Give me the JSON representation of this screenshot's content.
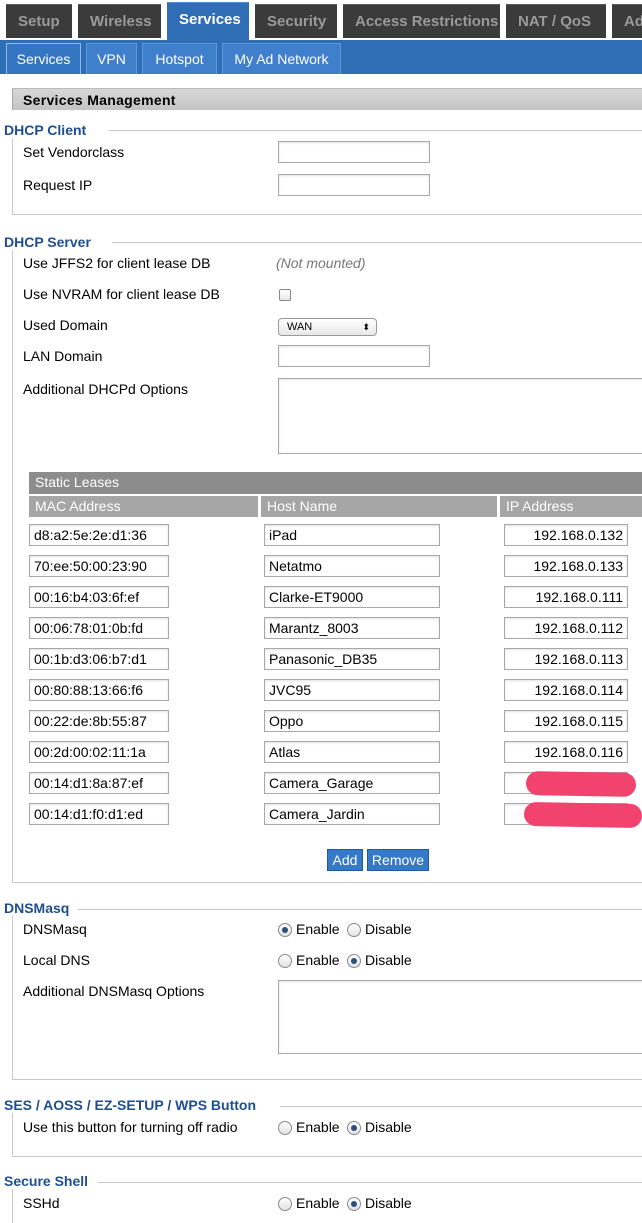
{
  "nav": {
    "tabs": [
      {
        "label": "Setup",
        "active": false
      },
      {
        "label": "Wireless",
        "active": false
      },
      {
        "label": "Services",
        "active": true
      },
      {
        "label": "Security",
        "active": false
      },
      {
        "label": "Access Restrictions",
        "active": false
      },
      {
        "label": "NAT / QoS",
        "active": false
      },
      {
        "label": "Ad",
        "active": false
      }
    ],
    "subtabs": [
      {
        "label": "Services",
        "active": true
      },
      {
        "label": "VPN",
        "active": false
      },
      {
        "label": "Hotspot",
        "active": false
      },
      {
        "label": "My Ad Network",
        "active": false
      }
    ]
  },
  "page": {
    "heading": "Services Management"
  },
  "dhcp_client": {
    "legend": "DHCP Client",
    "vendorclass_label": "Set Vendorclass",
    "vendorclass_value": "",
    "request_ip_label": "Request IP",
    "request_ip_value": ""
  },
  "dhcp_server": {
    "legend": "DHCP Server",
    "jffs2_label": "Use JFFS2 for client lease DB",
    "jffs2_status": "(Not mounted)",
    "nvram_label": "Use NVRAM for client lease DB",
    "nvram_checked": false,
    "used_domain_label": "Used Domain",
    "used_domain_value": "WAN",
    "lan_domain_label": "LAN Domain",
    "lan_domain_value": "",
    "additional_label": "Additional DHCPd Options",
    "additional_value": ""
  },
  "static_leases": {
    "title": "Static Leases",
    "columns": [
      "MAC Address",
      "Host Name",
      "IP Address"
    ],
    "rows": [
      {
        "mac": "d8:a2:5e:2e:d1:36",
        "host": "iPad",
        "ip": "192.168.0.132"
      },
      {
        "mac": "70:ee:50:00:23:90",
        "host": "Netatmo",
        "ip": "192.168.0.133"
      },
      {
        "mac": "00:16:b4:03:6f:ef",
        "host": "Clarke-ET9000",
        "ip": "192.168.0.111"
      },
      {
        "mac": "00:06:78:01:0b:fd",
        "host": "Marantz_8003",
        "ip": "192.168.0.112"
      },
      {
        "mac": "00:1b:d3:06:b7:d1",
        "host": "Panasonic_DB35",
        "ip": "192.168.0.113"
      },
      {
        "mac": "00:80:88:13:66:f6",
        "host": "JVC95",
        "ip": "192.168.0.114"
      },
      {
        "mac": "00:22:de:8b:55:87",
        "host": "Oppo",
        "ip": "192.168.0.115"
      },
      {
        "mac": "00:2d:00:02:11:1a",
        "host": "Atlas",
        "ip": "192.168.0.116"
      },
      {
        "mac": "00:14:d1:8a:87:ef",
        "host": "Camera_Garage",
        "ip": ""
      },
      {
        "mac": "00:14:d1:f0:d1:ed",
        "host": "Camera_Jardin",
        "ip": ""
      }
    ],
    "add_label": "Add",
    "remove_label": "Remove",
    "redaction_color": "#f2436e"
  },
  "dnsmasq": {
    "legend": "DNSMasq",
    "dnsmasq_label": "DNSMasq",
    "dnsmasq_selected": "Enable",
    "local_dns_label": "Local DNS",
    "local_dns_selected": "Disable",
    "additional_label": "Additional DNSMasq Options",
    "additional_value": ""
  },
  "wps": {
    "legend": "SES / AOSS / EZ-SETUP / WPS Button",
    "label": "Use this button for turning off radio",
    "selected": "Disable"
  },
  "ssh": {
    "legend": "Secure Shell",
    "label": "SSHd",
    "selected": "Disable"
  },
  "options": {
    "enable": "Enable",
    "disable": "Disable"
  },
  "colors": {
    "accent": "#2f6db5",
    "legend": "#1d4e92",
    "tab_bg": "#3b3b3b"
  }
}
